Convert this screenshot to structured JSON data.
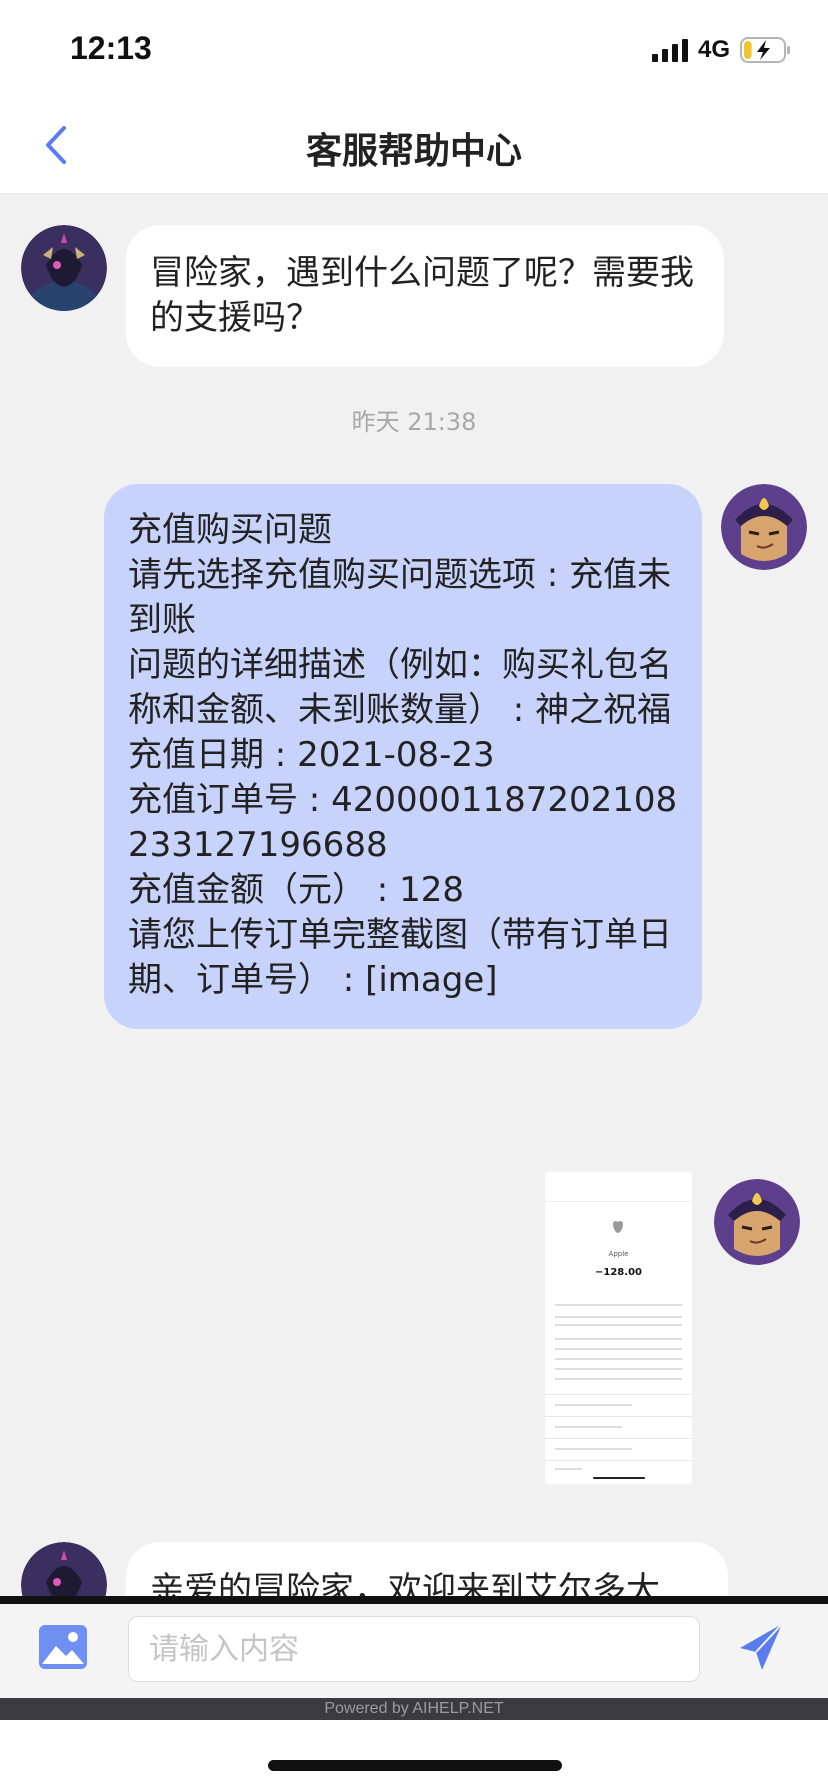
{
  "status_bar": {
    "time": "12:13",
    "network": "4G"
  },
  "header": {
    "title": "客服帮助中心"
  },
  "messages": {
    "greeting": "冒险家，遇到什么问题了呢？需要我的支援吗？",
    "timestamp": "昨天 21:38",
    "user_form": {
      "line1": "充值购买问题",
      "line2": "请先选择充值购买问题选项 : 充值未到账",
      "line3": "问题的详细描述（例如：购买礼包名称和金额、未到账数量） : 神之祝福",
      "line4": "充值日期 : 2021-08-23",
      "line5": "充值订单号 : 4200001187202108233127196688",
      "line6": "充值金额（元） : 128",
      "line7": "请您上传订单完整截图（带有订单日期、订单号） : [image]"
    },
    "receipt_image": {
      "merchant": "Apple",
      "amount": "−128.00"
    },
    "welcome": "亲爱的冒险家，欢迎来到艾尔多大"
  },
  "input": {
    "placeholder": "请输入内容"
  },
  "footer": {
    "powered_by": "Powered by AIHELP.NET"
  },
  "colors": {
    "accent": "#5b7cf0",
    "user_bubble": "#c8d3fb",
    "chat_bg": "#f1f1f1"
  },
  "battery": {
    "charging": true,
    "level": 0.2
  }
}
